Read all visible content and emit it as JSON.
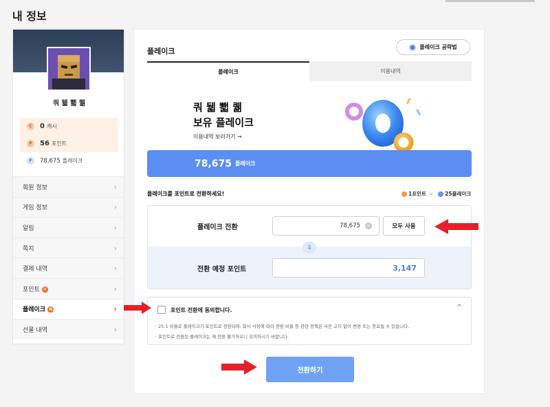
{
  "page": {
    "title": "내 정보"
  },
  "profile": {
    "nickname": "쿼 뒓 뾃 퀢"
  },
  "wallet": [
    {
      "icon": "C",
      "value": "0",
      "unit": "캐시"
    },
    {
      "icon": "P",
      "value": "56",
      "unit": "포인트"
    },
    {
      "icon": "F",
      "value": "78,675",
      "unit": "플레이크"
    }
  ],
  "menu": [
    {
      "label": "회원 정보",
      "badge": ""
    },
    {
      "label": "게임 정보",
      "badge": ""
    },
    {
      "label": "알림",
      "badge": ""
    },
    {
      "label": "쪽지",
      "badge": ""
    },
    {
      "label": "결제 내역",
      "badge": ""
    },
    {
      "label": "포인트",
      "badge": "N"
    },
    {
      "label": "플레이크",
      "badge": "N"
    },
    {
      "label": "선물 내역",
      "badge": ""
    }
  ],
  "main": {
    "section_title": "플레이크",
    "guide_button": "플레이크 공략법",
    "tabs": [
      "플레이크",
      "이용내역"
    ],
    "hero": {
      "nickname": "쿼 뒓 뾃 퀢",
      "subtitle": "보유 플레이크",
      "link": "이용내역 보러가기 →"
    },
    "balance": {
      "value": "78,675",
      "unit": "플레이크"
    },
    "convert_label": "플레이크를 포인트로 전환하세요!",
    "rate": {
      "left": "1포인트",
      "eq": "=",
      "right": "25플레이크"
    },
    "convert": {
      "flake_label": "플레이크 전환",
      "flake_value": "78,675",
      "clear_icon": "×",
      "all_button": "모두 사용",
      "arrow": "⇓",
      "point_label": "전환 예정 포인트",
      "point_value": "3,147"
    },
    "agree": {
      "label": "포인트 전환에 동의합니다.",
      "caret": "^",
      "notes": [
        "· 25:1 비율로 플레이크가 포인트로 전환되며, 회사 사정에 따라 전환 비율 등 관련 정책은 사전 고지 없이 변경 또는 종료될 수 있습니다.",
        "· 포인트로 전환된 플레이크는 재 전환 불가하오니 유의하시기 바랍니다."
      ]
    },
    "submit": "전환하기"
  },
  "colors": {
    "accent": "#5b8df2",
    "submit": "#6fa2f5",
    "annotation": "#e5202a"
  }
}
